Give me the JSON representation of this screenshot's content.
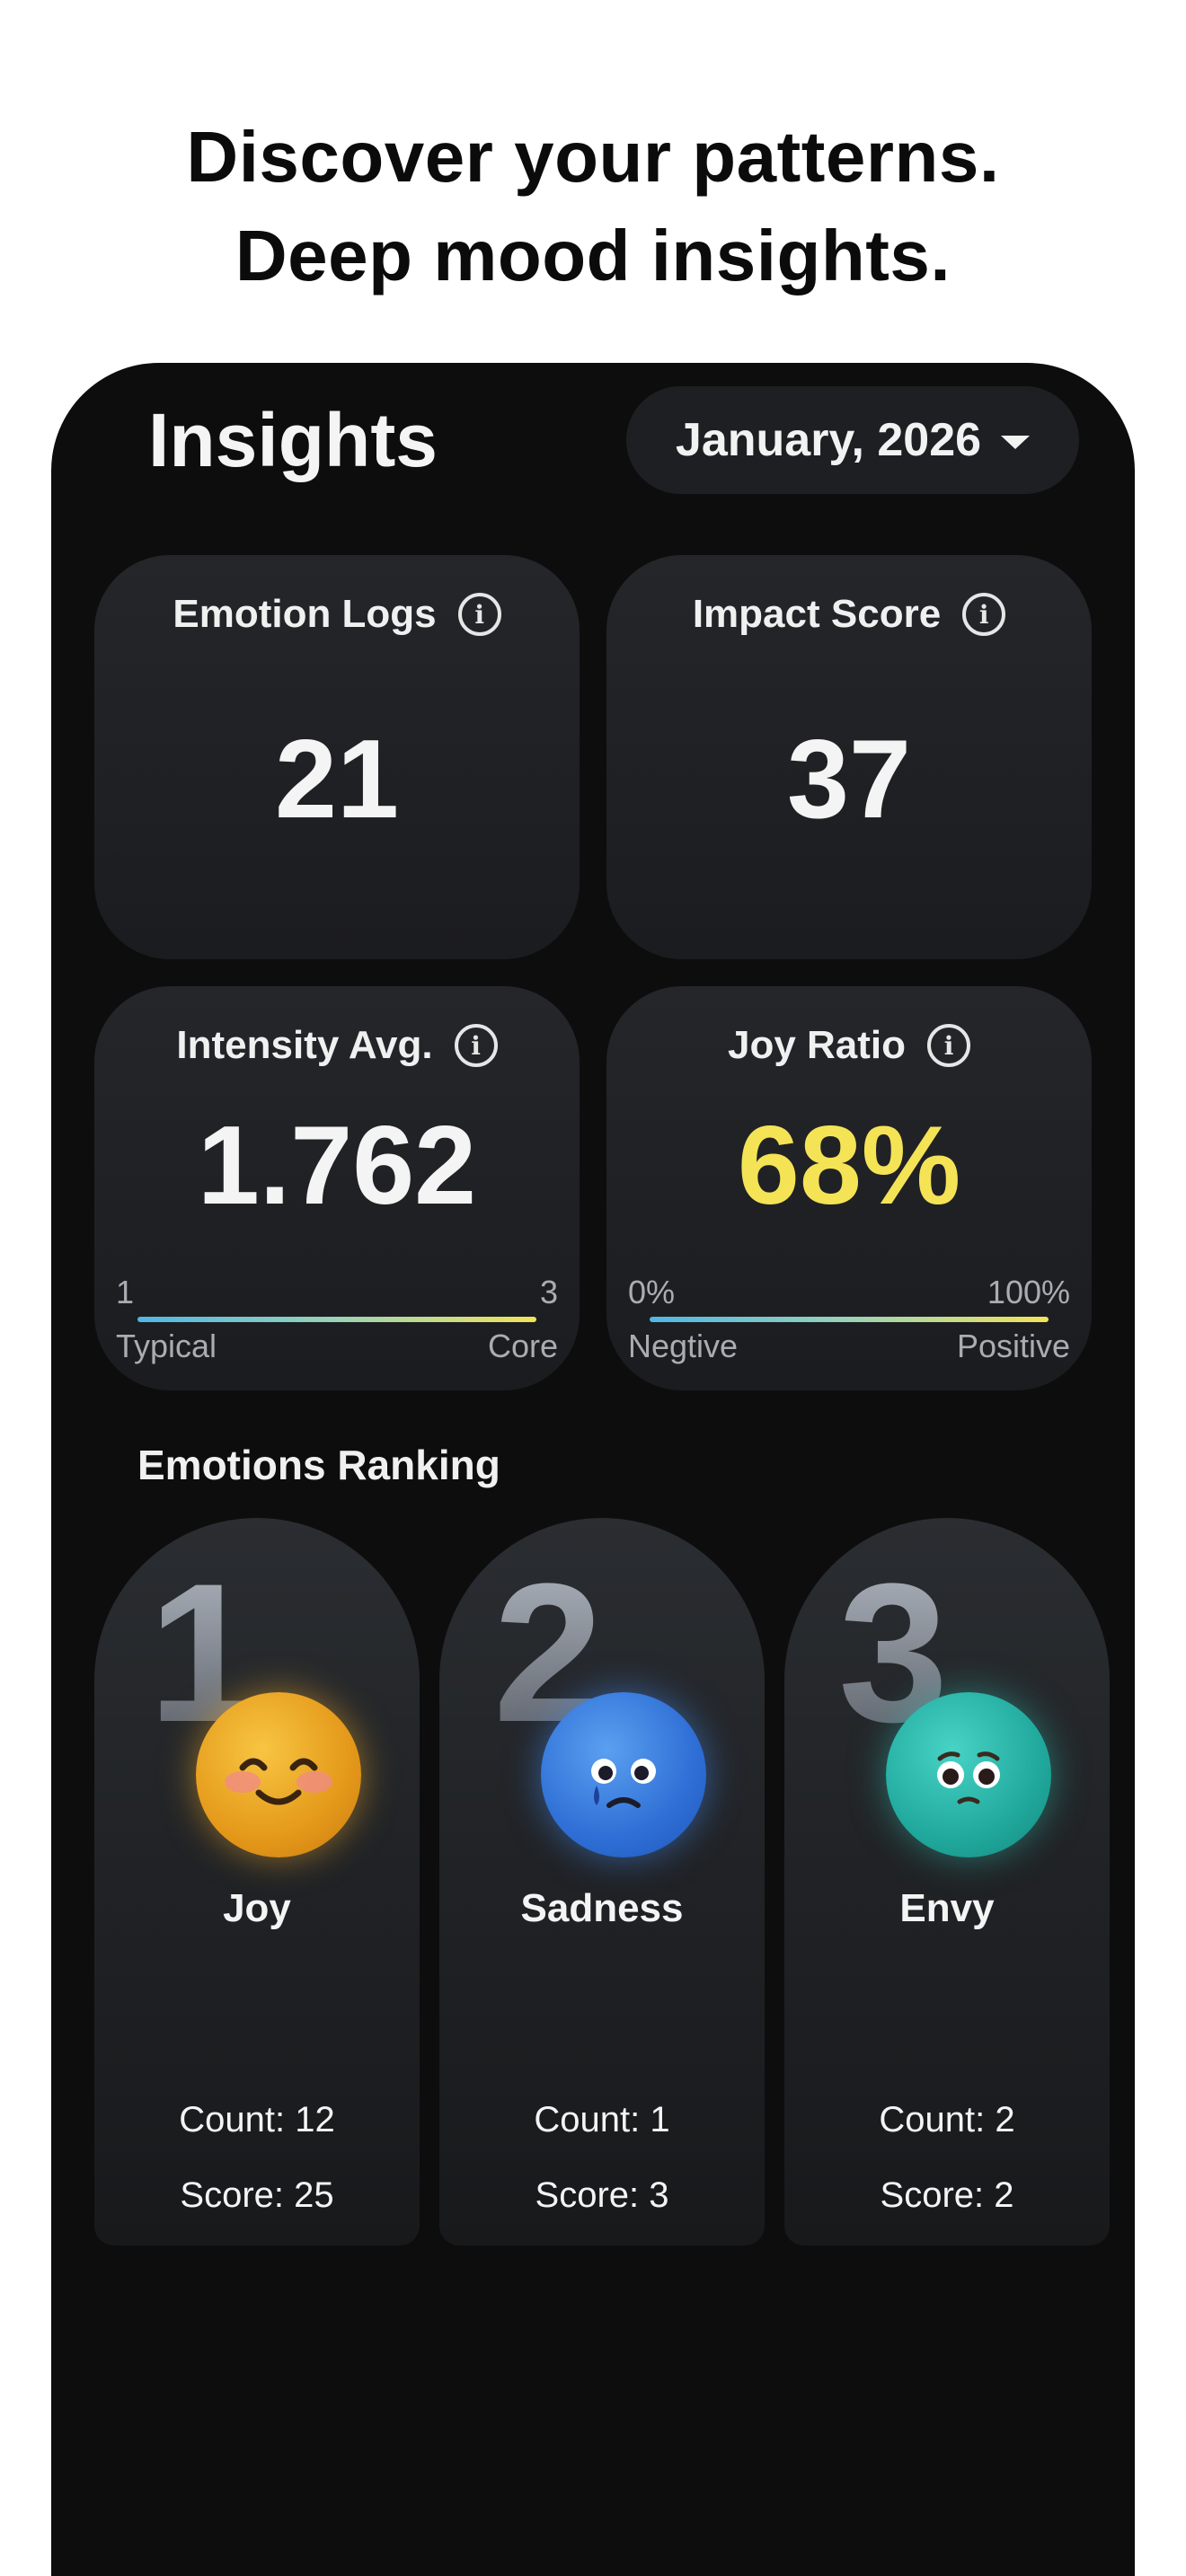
{
  "headline": {
    "line1": "Discover your patterns.",
    "line2": "Deep mood insights."
  },
  "header": {
    "title": "Insights",
    "month_label": "January, 2026"
  },
  "cards": {
    "emotion_logs": {
      "label": "Emotion Logs",
      "value": "21"
    },
    "impact_score": {
      "label": "Impact Score",
      "value": "37"
    },
    "intensity_avg": {
      "label": "Intensity Avg.",
      "value": "1.762",
      "scale_min": "1",
      "scale_max": "3",
      "left_label": "Typical",
      "right_label": "Core"
    },
    "joy_ratio": {
      "label": "Joy Ratio",
      "value": "68%",
      "value_color": "#f5e356",
      "scale_min": "0%",
      "scale_max": "100%",
      "left_label": "Negtive",
      "right_label": "Positive"
    }
  },
  "ranking": {
    "title": "Emotions Ranking",
    "items": [
      {
        "rank": "1",
        "name": "Joy",
        "count": "Count: 12",
        "score": "Score: 25",
        "icon": "smiling-face-icon",
        "color": "#e8a21d"
      },
      {
        "rank": "2",
        "name": "Sadness",
        "count": "Count: 1",
        "score": "Score: 3",
        "icon": "crying-face-icon",
        "color": "#3d7fe0"
      },
      {
        "rank": "3",
        "name": "Envy",
        "count": "Count: 2",
        "score": "Score: 2",
        "icon": "pleading-face-icon",
        "color": "#2fb7ad"
      }
    ]
  },
  "icons": {
    "info": "info-icon",
    "dropdown": "chevron-down-icon"
  }
}
